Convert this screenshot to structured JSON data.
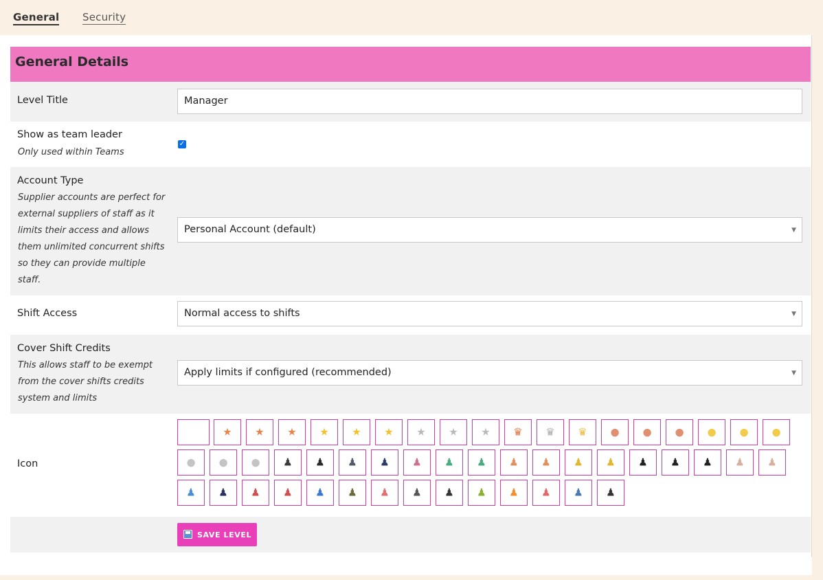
{
  "tabs": [
    {
      "label": "General",
      "active": true
    },
    {
      "label": "Security",
      "active": false
    }
  ],
  "section": {
    "title": "General Details"
  },
  "fields": {
    "level_title": {
      "label": "Level Title",
      "value": "Manager"
    },
    "team_leader": {
      "label": "Show as team leader",
      "description": "Only used within Teams",
      "checked": true
    },
    "account_type": {
      "label": "Account Type",
      "description": "Supplier accounts are perfect for external suppliers of staff as it limits their access and allows them unlimited concurrent shifts so they can provide multiple staff.",
      "selected": "Personal Account (default)"
    },
    "shift_access": {
      "label": "Shift Access",
      "selected": "Normal access to shifts"
    },
    "cover_credits": {
      "label": "Cover Shift Credits",
      "description": "This allows staff to be exempt from the cover shifts credits system and limits",
      "selected": "Apply limits if configured (recommended)"
    },
    "icon": {
      "label": "Icon"
    }
  },
  "icons": [
    {
      "name": "none",
      "glyph": "",
      "color": "#ffffff"
    },
    {
      "name": "star-bronze-icon",
      "glyph": "★",
      "color": "#e8844a"
    },
    {
      "name": "star-green-icon",
      "glyph": "★",
      "color": "#e8844a"
    },
    {
      "name": "star-blue-icon",
      "glyph": "★",
      "color": "#e8844a"
    },
    {
      "name": "star-gold-icon",
      "glyph": "★",
      "color": "#f2c230"
    },
    {
      "name": "star-gold-green-icon",
      "glyph": "★",
      "color": "#f2c230"
    },
    {
      "name": "star-gold-blue-icon",
      "glyph": "★",
      "color": "#f2c230"
    },
    {
      "name": "star-silver-icon",
      "glyph": "★",
      "color": "#b9b9b9"
    },
    {
      "name": "star-silver-green-icon",
      "glyph": "★",
      "color": "#b9b9b9"
    },
    {
      "name": "star-silver-blue-icon",
      "glyph": "★",
      "color": "#b9b9b9"
    },
    {
      "name": "crown-bronze-icon",
      "glyph": "♛",
      "color": "#e0743e"
    },
    {
      "name": "crown-silver-icon",
      "glyph": "♛",
      "color": "#a9a9a9"
    },
    {
      "name": "crown-gold-icon",
      "glyph": "♛",
      "color": "#e8b93a"
    },
    {
      "name": "medal-bronze-red-icon",
      "glyph": "●",
      "color": "#e09070"
    },
    {
      "name": "medal-bronze-green-icon",
      "glyph": "●",
      "color": "#e09070"
    },
    {
      "name": "medal-bronze-blue-icon",
      "glyph": "●",
      "color": "#e09070"
    },
    {
      "name": "medal-gold-red-icon",
      "glyph": "●",
      "color": "#f0cc4a"
    },
    {
      "name": "medal-gold-green-icon",
      "glyph": "●",
      "color": "#f0cc4a"
    },
    {
      "name": "medal-gold-blue-icon",
      "glyph": "●",
      "color": "#f0cc4a"
    },
    {
      "name": "medal-silver-red-icon",
      "glyph": "●",
      "color": "#c4c4c4"
    },
    {
      "name": "medal-silver-green-icon",
      "glyph": "●",
      "color": "#c4c4c4"
    },
    {
      "name": "medal-silver-blue-icon",
      "glyph": "●",
      "color": "#c4c4c4"
    },
    {
      "name": "person-business-woman-icon",
      "glyph": "♟",
      "color": "#3a3a3a"
    },
    {
      "name": "person-business-man-icon",
      "glyph": "♟",
      "color": "#2a2a2a"
    },
    {
      "name": "person-grey-man-icon",
      "glyph": "♟",
      "color": "#555a6a"
    },
    {
      "name": "person-navy-man-icon",
      "glyph": "♟",
      "color": "#2a3a6a"
    },
    {
      "name": "person-pink-woman-icon",
      "glyph": "♟",
      "color": "#d07090"
    },
    {
      "name": "person-green-woman-icon",
      "glyph": "♟",
      "color": "#4aaa80"
    },
    {
      "name": "person-green-man-icon",
      "glyph": "♟",
      "color": "#4aaa80"
    },
    {
      "name": "person-orange-woman-icon",
      "glyph": "♟",
      "color": "#e09060"
    },
    {
      "name": "person-orange-man-icon",
      "glyph": "♟",
      "color": "#e09060"
    },
    {
      "name": "person-yellow-woman-icon",
      "glyph": "♟",
      "color": "#e0b830"
    },
    {
      "name": "person-yellow-man-icon",
      "glyph": "♟",
      "color": "#e0b830"
    },
    {
      "name": "person-shadow-icon",
      "glyph": "♟",
      "color": "#222222"
    },
    {
      "name": "person-sunglasses-icon",
      "glyph": "♟",
      "color": "#222222"
    },
    {
      "name": "person-spy-icon",
      "glyph": "♟",
      "color": "#222222"
    },
    {
      "name": "person-white-woman-icon",
      "glyph": "♟",
      "color": "#d8b0a0"
    },
    {
      "name": "person-white-man-icon",
      "glyph": "♟",
      "color": "#d8b0a0"
    },
    {
      "name": "person-blue-icon",
      "glyph": "♟",
      "color": "#4a90d0"
    },
    {
      "name": "person-hat-icon",
      "glyph": "♟",
      "color": "#2a3060"
    },
    {
      "name": "person-red-woman-icon",
      "glyph": "♟",
      "color": "#d05050"
    },
    {
      "name": "person-red-man-icon",
      "glyph": "♟",
      "color": "#d05050"
    },
    {
      "name": "person-blue-child-icon",
      "glyph": "♟",
      "color": "#3a7ad0"
    },
    {
      "name": "person-army-icon",
      "glyph": "♟",
      "color": "#6a6a3a"
    },
    {
      "name": "person-red-woman-2-icon",
      "glyph": "♟",
      "color": "#e07070"
    },
    {
      "name": "person-grey-2-icon",
      "glyph": "♟",
      "color": "#555555"
    },
    {
      "name": "person-ninja-icon",
      "glyph": "♟",
      "color": "#333333"
    },
    {
      "name": "person-green-child-icon",
      "glyph": "♟",
      "color": "#8ab030"
    },
    {
      "name": "person-orange-child-icon",
      "glyph": "♟",
      "color": "#f09030"
    },
    {
      "name": "person-pink-child-icon",
      "glyph": "♟",
      "color": "#e06a6a"
    },
    {
      "name": "person-blue-shirt-icon",
      "glyph": "♟",
      "color": "#4a7ab0"
    },
    {
      "name": "person-dark-icon",
      "glyph": "♟",
      "color": "#333333"
    }
  ],
  "save_button": {
    "label": "SAVE LEVEL"
  }
}
